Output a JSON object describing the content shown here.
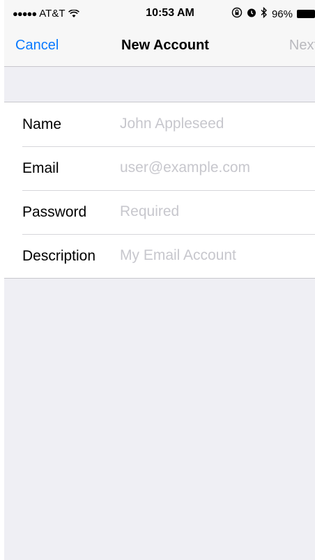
{
  "status_bar": {
    "carrier": "AT&T",
    "signal_dots": "●●●●●",
    "time": "10:53 AM",
    "battery_percent": "96%",
    "icons": [
      "signal-dots",
      "wifi-icon",
      "rotation-lock-icon",
      "alarm-icon",
      "bluetooth-icon",
      "battery-icon"
    ]
  },
  "nav": {
    "cancel_label": "Cancel",
    "title": "New Account",
    "next_label": "Next"
  },
  "form": {
    "rows": [
      {
        "label": "Name",
        "placeholder": "John Appleseed",
        "value": ""
      },
      {
        "label": "Email",
        "placeholder": "user@example.com",
        "value": ""
      },
      {
        "label": "Password",
        "placeholder": "Required",
        "value": ""
      },
      {
        "label": "Description",
        "placeholder": "My Email Account",
        "value": ""
      }
    ]
  },
  "colors": {
    "accent": "#0a7aff",
    "disabled": "#b9b9be",
    "placeholder": "#c7c7cd",
    "background": "#efeff4"
  }
}
